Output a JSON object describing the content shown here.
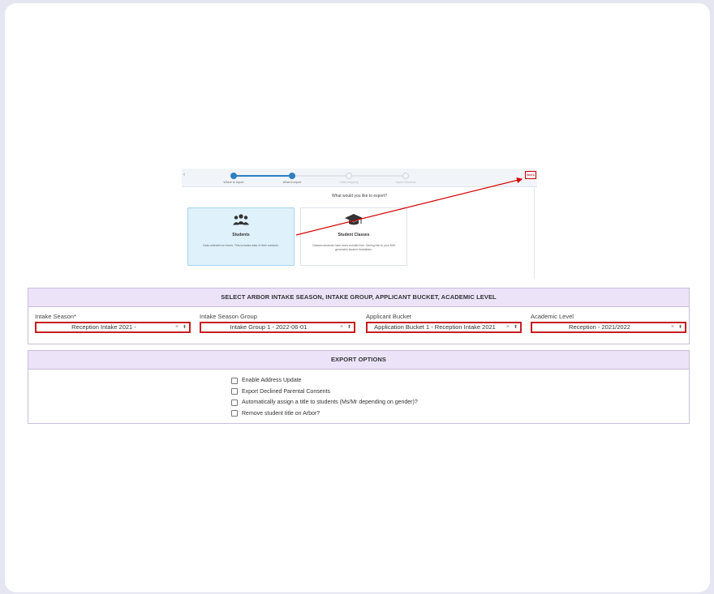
{
  "embedded": {
    "steps": [
      {
        "label": "Where to export",
        "state": "done"
      },
      {
        "label": "What to export",
        "state": "active"
      },
      {
        "label": "Class Mapping",
        "state": "pending"
      },
      {
        "label": "Import Students",
        "state": "pending"
      }
    ],
    "next_label": "Next ▸",
    "question": "What would you like to export?",
    "options": [
      {
        "title": "Students",
        "desc": "Data collected on forms. This includes data of their contacts.",
        "icon": "people-icon",
        "selected": true
      },
      {
        "title": "Student Classes",
        "desc": "Classes students have been enrolled into. Saving this to your MIS generates student timetables.",
        "icon": "graduation-cap-icon",
        "selected": false
      }
    ],
    "back_icon": "‹"
  },
  "intake_panel": {
    "title": "SELECT ARBOR INTAKE SEASON, INTAKE GROUP, APPLICANT BUCKET, ACADEMIC LEVEL",
    "fields": [
      {
        "label": "Intake Season*",
        "value": "Reception Intake 2021 -"
      },
      {
        "label": "Intake Season Group",
        "value": "Intake Group 1 - 2022-06-01"
      },
      {
        "label": "Applicant Bucket",
        "value": "Application Bucket 1 - Reception Intake 2021"
      },
      {
        "label": "Academic Level",
        "value": "Reception - 2021/2022"
      }
    ],
    "clear_glyph": "×",
    "caret_glyph": "⬍"
  },
  "export_panel": {
    "title": "EXPORT OPTIONS",
    "options": [
      {
        "label": "Enable Address Update",
        "checked": false
      },
      {
        "label": "Export Declined Parental Consents",
        "checked": false
      },
      {
        "label": "Automatically assign a title to students (Ms/Mr depending on gender)?",
        "checked": false
      },
      {
        "label": "Remove student title on Arbor?",
        "checked": false
      }
    ]
  },
  "colors": {
    "highlight": "#c71d1d",
    "panel_header": "#ece3f9",
    "step_blue": "#2d7fc1",
    "selected_card": "#dff1fb"
  }
}
